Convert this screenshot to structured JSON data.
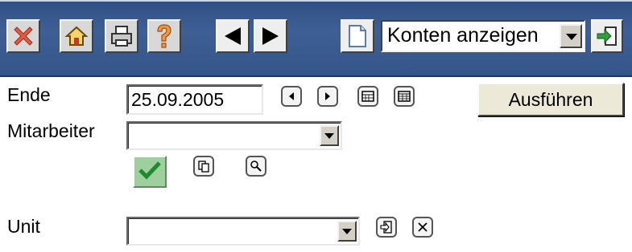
{
  "toolbar": {
    "icons": [
      "close-icon",
      "home-icon",
      "print-icon",
      "help-icon",
      "arrow-left-icon",
      "arrow-right-icon",
      "document-icon",
      "go-icon"
    ],
    "view_select_value": "Konten anzeigen"
  },
  "form": {
    "end_label": "Ende",
    "end_value": "25.09.2005",
    "employee_label": "Mitarbeiter",
    "employee_value": "",
    "unit_label": "Unit",
    "unit_value": "",
    "run_button": "Ausführen"
  },
  "colors": {
    "toolbar_bg": "#3a5a90",
    "close_red": "#e0503c",
    "help_orange": "#f0963c",
    "ok_green": "#9fcf9f"
  }
}
